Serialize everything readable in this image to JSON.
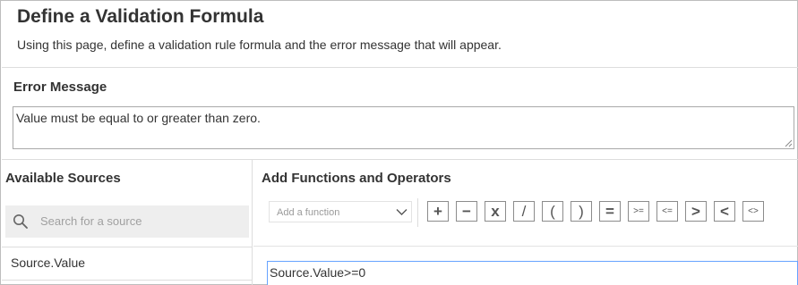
{
  "page": {
    "title": "Define a Validation Formula",
    "description": "Using this page, define a validation rule formula and the error message that will appear."
  },
  "error_message": {
    "label": "Error Message",
    "value": "Value must be equal to or greater than zero."
  },
  "sources": {
    "title": "Available Sources",
    "search_placeholder": "Search for a source",
    "items": [
      {
        "label": "Source.Value"
      }
    ]
  },
  "functions": {
    "title": "Add Functions and Operators",
    "select_placeholder": "Add a function",
    "operators": [
      {
        "symbol": "+",
        "icon": "plus-icon"
      },
      {
        "symbol": "−",
        "icon": "minus-icon"
      },
      {
        "symbol": "x",
        "icon": "multiply-icon"
      },
      {
        "symbol": "/",
        "icon": "divide-icon"
      },
      {
        "symbol": "(",
        "icon": "open-paren-icon"
      },
      {
        "symbol": ")",
        "icon": "close-paren-icon"
      },
      {
        "symbol": "=",
        "icon": "equals-icon"
      },
      {
        "symbol": ">=",
        "icon": "greater-equal-icon"
      },
      {
        "symbol": "<=",
        "icon": "less-equal-icon"
      },
      {
        "symbol": ">",
        "icon": "greater-than-icon"
      },
      {
        "symbol": "<",
        "icon": "less-than-icon"
      },
      {
        "symbol": "<>",
        "icon": "not-equal-icon"
      }
    ]
  },
  "formula": {
    "value": "Source.Value>=0"
  },
  "colors": {
    "text": "#333333",
    "border": "#dddddd",
    "search_bg": "#eeeeee",
    "focus_border": "#66a3ff",
    "placeholder": "#a0a0a0"
  }
}
